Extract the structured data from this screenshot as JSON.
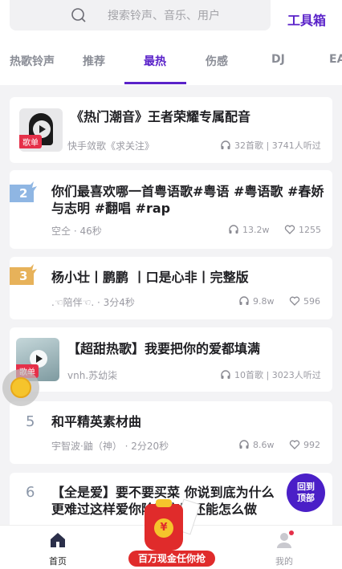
{
  "search": {
    "placeholder": "搜索铃声、音乐、用户"
  },
  "toolbar": {
    "toolbox_label": "工具箱"
  },
  "tabs": [
    "热歌铃声",
    "推荐",
    "最热",
    "伤感",
    "DJ",
    "EA"
  ],
  "active_tab": "最热",
  "items": [
    {
      "title": "《热门潮音》王者荣耀专属配音",
      "tag": "歌单",
      "author": "快手敛歌《求关注》",
      "songs": "32首歌 | 3741人听过"
    },
    {
      "rank": "2",
      "title_line1": "你们最喜欢哪一首粤语歌#粤语 #粤语歌 #春娇",
      "title_line2": "与志明 #翻唱 #rap",
      "author": "空仝",
      "duration": "46秒",
      "plays": "13.2w",
      "likes": "1255"
    },
    {
      "rank": "3",
      "title": "杨小壮丨鹏鹏 丨口是心非丨完整版",
      "author": ".☜陪伴☜.",
      "duration": "3分4秒",
      "plays": "9.8w",
      "likes": "596"
    },
    {
      "title": "【超甜热歌】我要把你的爱都填满",
      "tag": "歌单",
      "author": "vnh.苏幼柒",
      "songs": "10首歌 | 3023人听过"
    },
    {
      "rank": "5",
      "title": "和平精英素材曲",
      "author": "宇智波·鼬（神）",
      "duration": "2分20秒",
      "plays": "8.6w",
      "likes": "992"
    },
    {
      "rank": "6",
      "title_line1": "【全是爱】要不要买菜 你说到底为什么",
      "title_line2": "更难过这样爱你除了安慰还能怎么做"
    }
  ],
  "back_to_top": {
    "line1": "回到",
    "line2": "顶部"
  },
  "bottom_nav": {
    "home": "首页",
    "mine": "我的"
  },
  "promo": {
    "label": "百万现金任你抢",
    "yen": "¥"
  },
  "colors": {
    "accent": "#5a22c9",
    "tag_red": "#e53049",
    "badge_blue": "#8fb6e3",
    "badge_gold": "#e7b25a"
  },
  "icons": [
    "search-icon",
    "headphones-icon",
    "heart-icon",
    "play-icon",
    "home-icon",
    "user-icon",
    "coin-icon"
  ]
}
